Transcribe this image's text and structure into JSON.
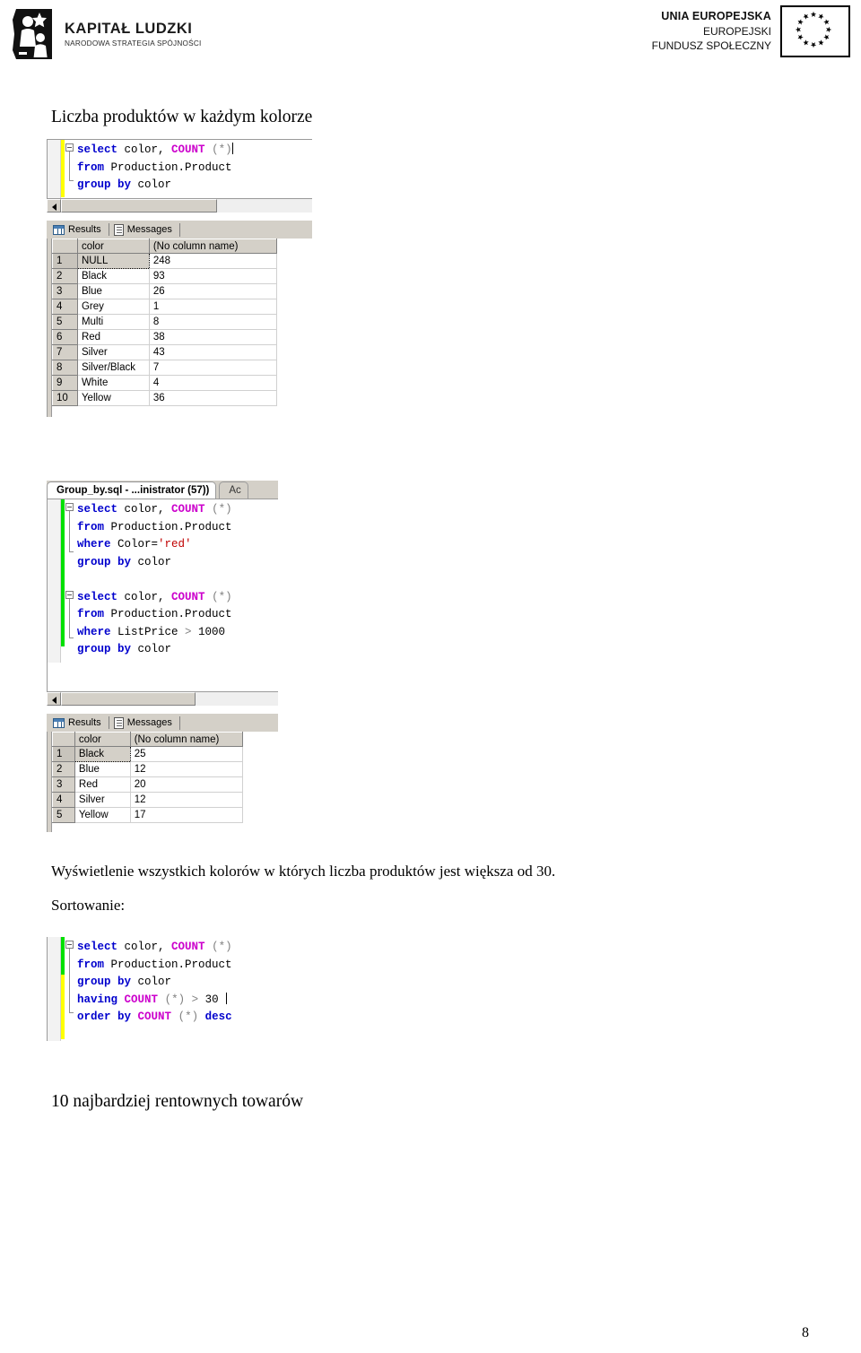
{
  "header": {
    "left_logo": {
      "title": "KAPITAŁ LUDZKI",
      "subtitle": "NARODOWA STRATEGIA SPÓJNOŚCI",
      "mark_name": "kapital-ludzki-mark"
    },
    "right_logo": {
      "line1": "UNIA EUROPEJSKA",
      "line2": "EUROPEJSKI",
      "line3": "FUNDUSZ SPOŁECZNY",
      "flag_name": "eu-flag"
    }
  },
  "document": {
    "heading_1": "Liczba produktów w każdym kolorze",
    "paragraph_1": "Wyświetlenie wszystkich kolorów w których liczba produktów jest większa od 30.",
    "paragraph_2": "Sortowanie:",
    "heading_2": "10 najbardziej rentownych towarów",
    "page_number": "8"
  },
  "screenshot_1": {
    "editor": {
      "change_bar_color": "#ffff00",
      "lines": [
        [
          {
            "t": "select",
            "c": "kw"
          },
          {
            "t": " color, ",
            "c": "idn"
          },
          {
            "t": "COUNT",
            "c": "fn"
          },
          {
            "t": " ",
            "c": "idn"
          },
          {
            "t": "(*)",
            "c": "gry"
          }
        ],
        [
          {
            "t": "from",
            "c": "kw"
          },
          {
            "t": " Production.Product",
            "c": "idn"
          }
        ],
        [
          {
            "t": "group by",
            "c": "kw"
          },
          {
            "t": " color",
            "c": "idn"
          }
        ]
      ]
    },
    "result_tabs": [
      {
        "label": "Results",
        "icon": "grid-icon",
        "active": true
      },
      {
        "label": "Messages",
        "icon": "messages-icon",
        "active": false
      }
    ],
    "grid": {
      "columns": [
        "",
        "color",
        "(No column name)"
      ],
      "rows": [
        [
          "1",
          "NULL",
          "248"
        ],
        [
          "2",
          "Black",
          "93"
        ],
        [
          "3",
          "Blue",
          "26"
        ],
        [
          "4",
          "Grey",
          "1"
        ],
        [
          "5",
          "Multi",
          "8"
        ],
        [
          "6",
          "Red",
          "38"
        ],
        [
          "7",
          "Silver",
          "43"
        ],
        [
          "8",
          "Silver/Black",
          "7"
        ],
        [
          "9",
          "White",
          "4"
        ],
        [
          "10",
          "Yellow",
          "36"
        ]
      ],
      "selected_cell": {
        "row": 0,
        "col": 1
      }
    }
  },
  "screenshot_2": {
    "tabs": [
      {
        "label": "Group_by.sql - ...inistrator (57))",
        "active": true
      },
      {
        "label": "Ac",
        "active": false
      }
    ],
    "editor": {
      "change_bar_color": "#00e000",
      "block_a": [
        [
          {
            "t": "select",
            "c": "kw"
          },
          {
            "t": " color, ",
            "c": "idn"
          },
          {
            "t": "COUNT",
            "c": "fn"
          },
          {
            "t": " ",
            "c": "idn"
          },
          {
            "t": "(*)",
            "c": "gry"
          }
        ],
        [
          {
            "t": "from",
            "c": "kw"
          },
          {
            "t": " Production.Product",
            "c": "idn"
          }
        ],
        [
          {
            "t": "where",
            "c": "kw"
          },
          {
            "t": " Color=",
            "c": "idn"
          },
          {
            "t": "'red'",
            "c": "str"
          }
        ],
        [
          {
            "t": "group by",
            "c": "kw"
          },
          {
            "t": " color",
            "c": "idn"
          }
        ]
      ],
      "block_b": [
        [
          {
            "t": "select",
            "c": "kw"
          },
          {
            "t": " color, ",
            "c": "idn"
          },
          {
            "t": "COUNT",
            "c": "fn"
          },
          {
            "t": " ",
            "c": "idn"
          },
          {
            "t": "(*)",
            "c": "gry"
          }
        ],
        [
          {
            "t": "from",
            "c": "kw"
          },
          {
            "t": " Production.Product",
            "c": "idn"
          }
        ],
        [
          {
            "t": "where",
            "c": "kw"
          },
          {
            "t": " ListPrice ",
            "c": "idn"
          },
          {
            "t": "> ",
            "c": "gry"
          },
          {
            "t": "1000",
            "c": "num"
          }
        ],
        [
          {
            "t": "group by",
            "c": "kw"
          },
          {
            "t": " color",
            "c": "idn"
          }
        ]
      ]
    },
    "result_tabs": [
      {
        "label": "Results",
        "icon": "grid-icon",
        "active": true
      },
      {
        "label": "Messages",
        "icon": "messages-icon",
        "active": false
      }
    ],
    "grid": {
      "columns": [
        "",
        "color",
        "(No column name)"
      ],
      "rows": [
        [
          "1",
          "Black",
          "25"
        ],
        [
          "2",
          "Blue",
          "12"
        ],
        [
          "3",
          "Red",
          "20"
        ],
        [
          "4",
          "Silver",
          "12"
        ],
        [
          "5",
          "Yellow",
          "17"
        ]
      ],
      "selected_cell": {
        "row": 0,
        "col": 1
      }
    }
  },
  "screenshot_3": {
    "editor": {
      "change_bar_top_color": "#00e000",
      "change_bar_bottom_color": "#ffff00",
      "lines": [
        [
          {
            "t": "select",
            "c": "kw"
          },
          {
            "t": " color, ",
            "c": "idn"
          },
          {
            "t": "COUNT",
            "c": "fn"
          },
          {
            "t": " ",
            "c": "idn"
          },
          {
            "t": "(*)",
            "c": "gry"
          }
        ],
        [
          {
            "t": "from",
            "c": "kw"
          },
          {
            "t": " Production.Product",
            "c": "idn"
          }
        ],
        [
          {
            "t": "group by",
            "c": "kw"
          },
          {
            "t": " color",
            "c": "idn"
          }
        ],
        [
          {
            "t": "having",
            "c": "kw"
          },
          {
            "t": " ",
            "c": "idn"
          },
          {
            "t": "COUNT",
            "c": "fn"
          },
          {
            "t": " ",
            "c": "idn"
          },
          {
            "t": "(*)",
            "c": "gry"
          },
          {
            "t": " ",
            "c": "idn"
          },
          {
            "t": ">",
            "c": "gry"
          },
          {
            "t": " ",
            "c": "idn"
          },
          {
            "t": "30",
            "c": "num"
          }
        ],
        [
          {
            "t": "order by",
            "c": "kw"
          },
          {
            "t": " ",
            "c": "idn"
          },
          {
            "t": "COUNT",
            "c": "fn"
          },
          {
            "t": " ",
            "c": "idn"
          },
          {
            "t": "(*)",
            "c": "gry"
          },
          {
            "t": " ",
            "c": "idn"
          },
          {
            "t": "desc",
            "c": "kw"
          }
        ]
      ]
    }
  }
}
